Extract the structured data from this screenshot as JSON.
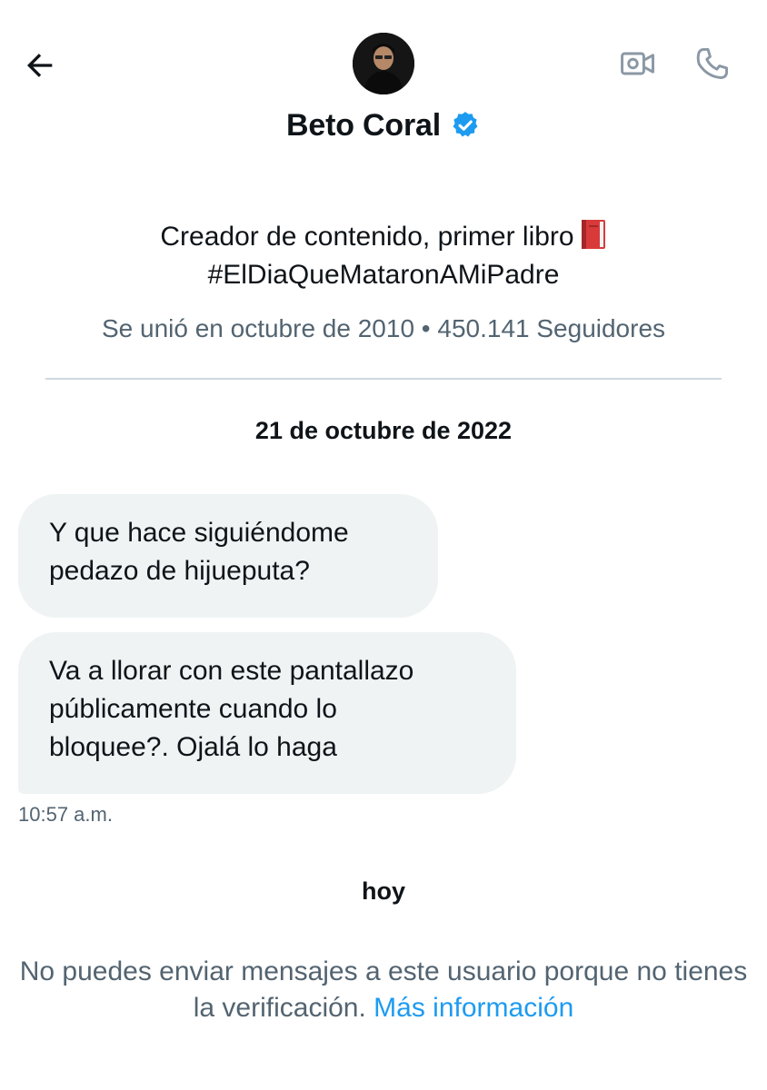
{
  "header": {
    "back_icon": "arrow-left-icon",
    "video_icon": "video-camera-icon",
    "call_icon": "phone-icon",
    "name": "Beto Coral",
    "verified_icon": "verified-badge-icon",
    "verified_color": "#1d9bf0"
  },
  "profile": {
    "bio_line1": "Creador de contenido, primer libro",
    "bio_emoji_icon": "red-book-icon",
    "bio_line2": "#ElDiaQueMataronAMiPadre",
    "meta": "Se unió en octubre de 2010 • 450.141 Seguidores"
  },
  "conversation": {
    "date_label": "21 de octubre de 2022",
    "messages": [
      {
        "text_line1": "Y que hace siguiéndome",
        "text_line2": "pedazo de hijueputa?"
      },
      {
        "text_line1": "Va a llorar con este pantallazo",
        "text_line2": "públicamente cuando lo",
        "text_line3": "bloquee?. Ojalá lo haga"
      }
    ],
    "last_time": "10:57 a.m.",
    "today_label": "hoy"
  },
  "notice": {
    "text": "No puedes enviar mensajes a este usuario porque no tienes la verificación.",
    "link": "Más información",
    "link_color": "#1d9bf0"
  }
}
